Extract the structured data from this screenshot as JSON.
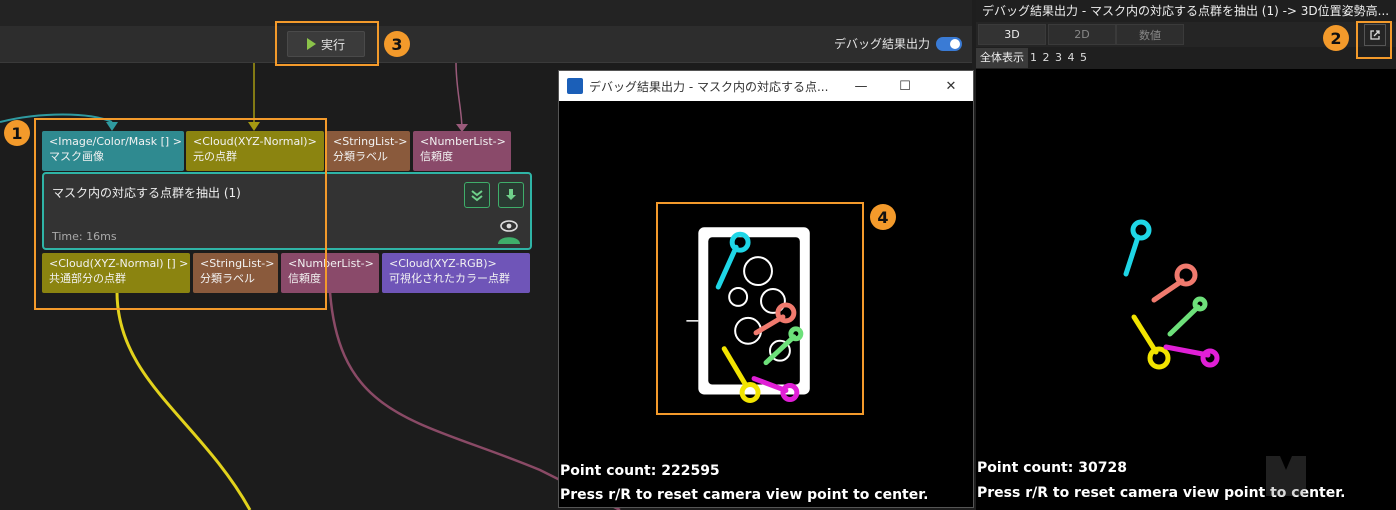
{
  "toolbar": {
    "run_label": "実行",
    "debug_output_label": "デバッグ結果出力",
    "debug_output_enabled": true
  },
  "callouts": [
    "1",
    "2",
    "3",
    "4"
  ],
  "node": {
    "title": "マスク内の対応する点群を抽出 (1)",
    "time": "Time: 16ms",
    "inputs": [
      {
        "type": "<Image/Color/Mask [] >",
        "label": "マスク画像"
      },
      {
        "type": "<Cloud(XYZ-Normal)>",
        "label": "元の点群"
      },
      {
        "type": "<StringList->",
        "label": "分類ラベル"
      },
      {
        "type": "<NumberList->",
        "label": "信頼度"
      }
    ],
    "outputs": [
      {
        "type": "<Cloud(XYZ-Normal) [] >",
        "label": "共通部分の点群"
      },
      {
        "type": "<StringList->",
        "label": "分類ラベル"
      },
      {
        "type": "<NumberList->",
        "label": "信頼度"
      },
      {
        "type": "<Cloud(XYZ-RGB)>",
        "label": "可視化されたカラー点群"
      }
    ]
  },
  "popup": {
    "title": "デバッグ結果出力 - マスク内の対応する点...",
    "point_count": "Point count: 222595",
    "hint": "Press r/R to reset camera view point to center."
  },
  "right_panel": {
    "title": "デバッグ結果出力 - マスク内の対応する点群を抽出 (1) -> 3D位置姿勢高...",
    "tabs": [
      "3D",
      "2D",
      "数値"
    ],
    "active_tab": "3D",
    "view_all": "全体表示",
    "pages": "1 2 3 4 5",
    "point_count": "Point count: 30728",
    "hint": "Press r/R to reset camera view point to center."
  },
  "colors": {
    "accent": "#f39a2b",
    "node_border": "#2fb4a6",
    "cyan_part": "#1fd6e6",
    "salmon_part": "#f07a6e",
    "green_part": "#6de07a",
    "yellow_part": "#f2e400",
    "magenta_part": "#e01fd6"
  },
  "icons": [
    "play-icon",
    "toggle-switch",
    "double-chevron-down-icon",
    "download-icon",
    "eye-person-icon",
    "app-icon",
    "minimize-icon",
    "maximize-icon",
    "close-icon",
    "popout-icon"
  ]
}
